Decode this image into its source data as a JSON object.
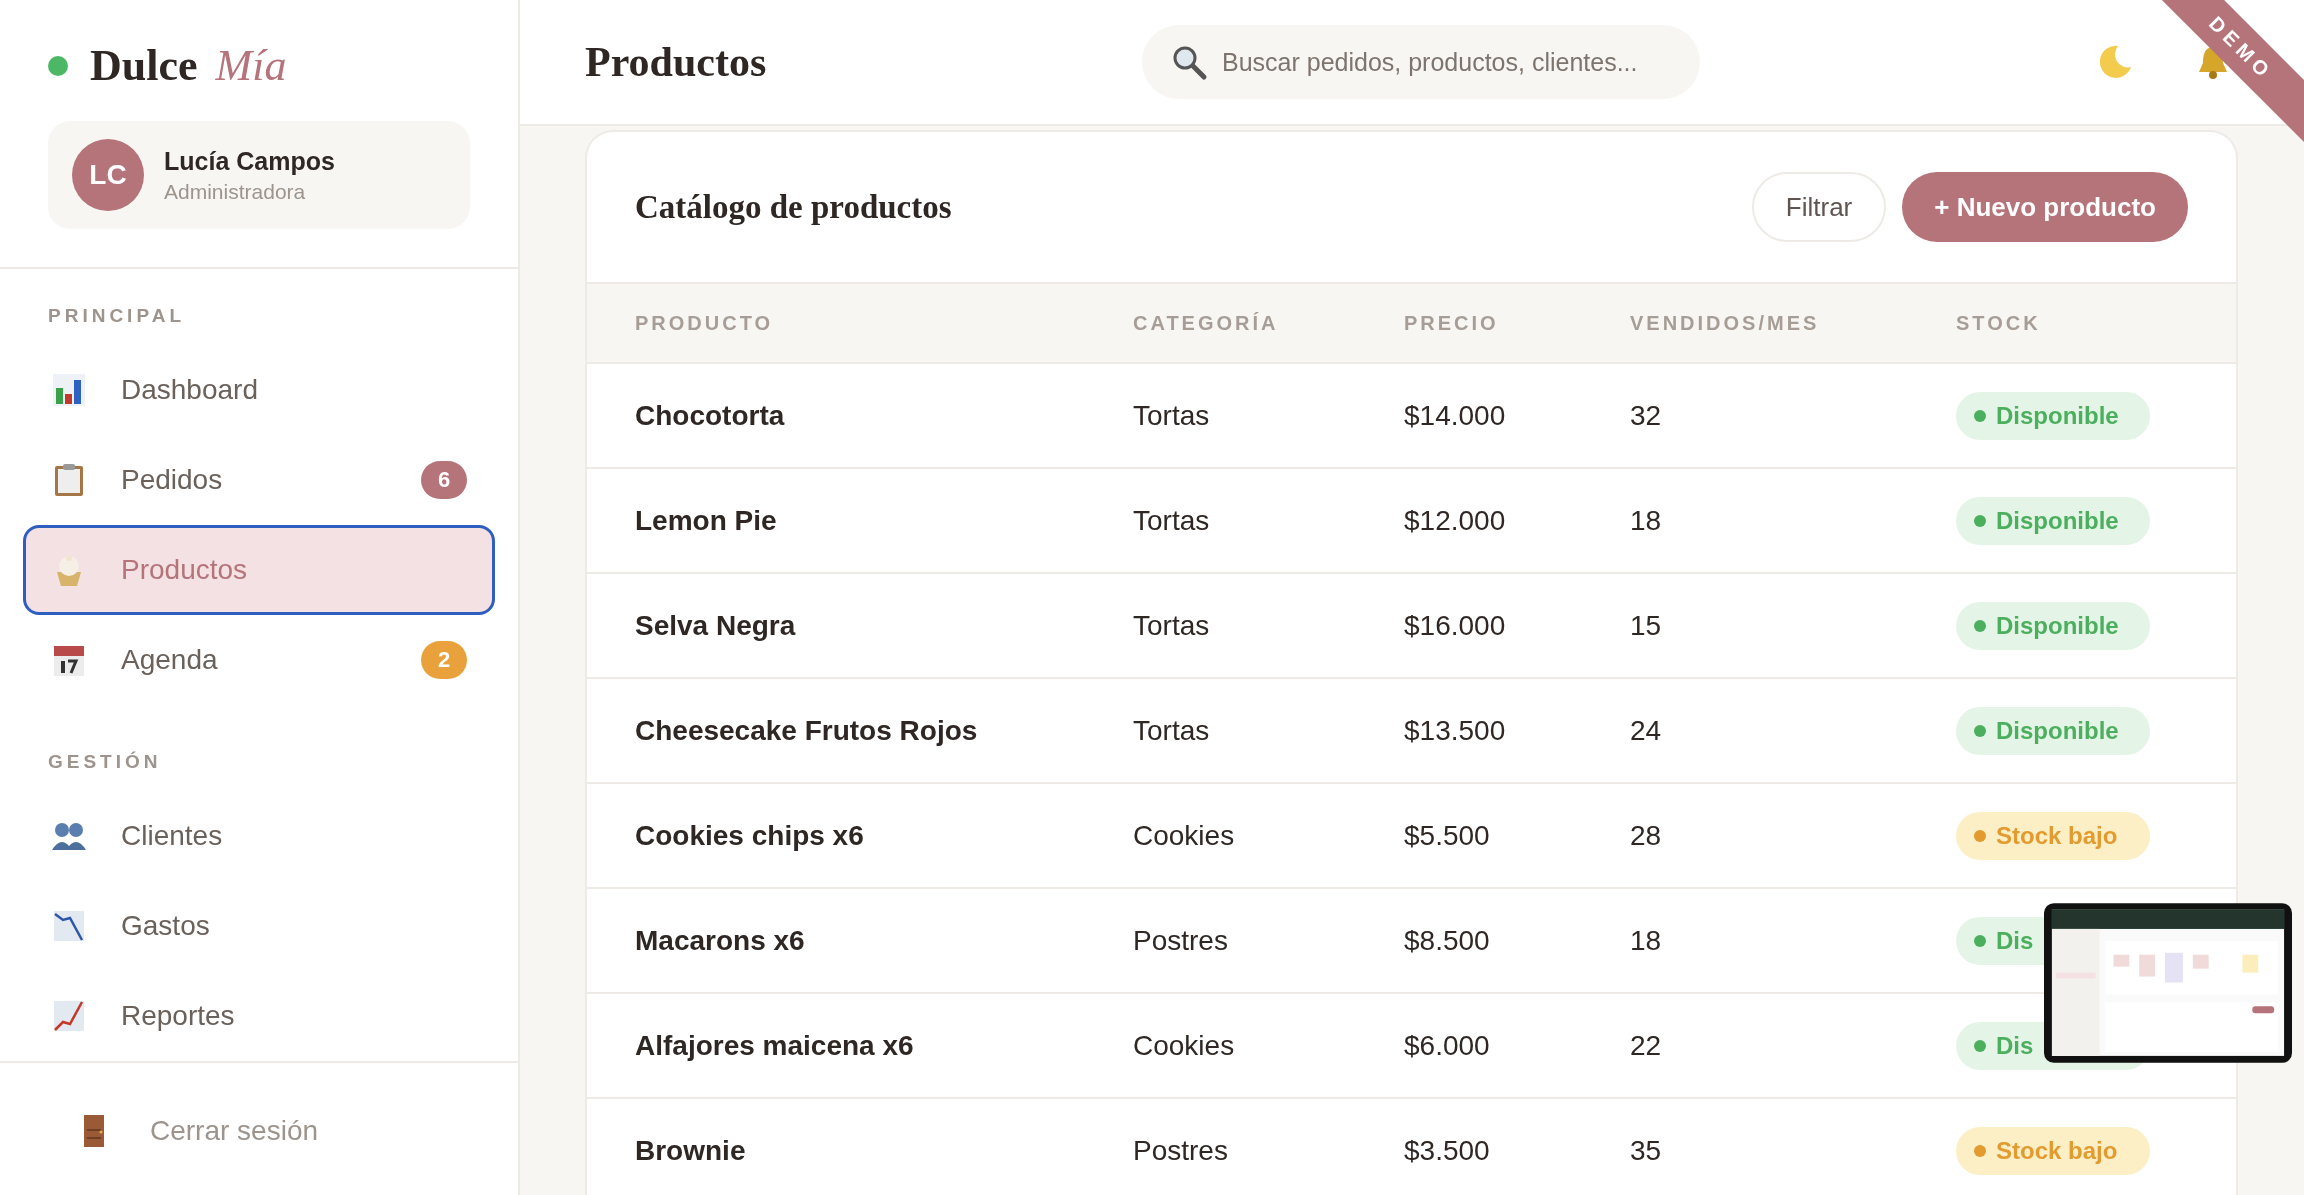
{
  "brand": {
    "name": "Dulce",
    "accent": "Mía"
  },
  "user": {
    "initials": "LC",
    "name": "Lucía Campos",
    "role": "Administradora"
  },
  "nav": [
    {
      "title": "PRINCIPAL",
      "items": [
        {
          "label": "Dashboard",
          "selected": false
        },
        {
          "label": "Pedidos",
          "selected": false,
          "badge": "6",
          "color": "#b5737a"
        },
        {
          "label": "Productos",
          "selected": true
        },
        {
          "label": "Agenda",
          "selected": false,
          "badge": "2",
          "color": "#e9a23b"
        }
      ]
    },
    {
      "title": "GESTIÓN",
      "items": [
        {
          "label": "Clientes",
          "selected": false
        },
        {
          "label": "Gastos",
          "selected": false
        },
        {
          "label": "Reportes",
          "selected": false
        }
      ]
    }
  ],
  "logout": {
    "label": "Cerrar sesión"
  },
  "page_title": "Productos",
  "search": {
    "placeholder": "Buscar pedidos, productos, clientes..."
  },
  "ribbon": "DEMO",
  "card": {
    "title": "Catálogo de productos",
    "buttons": [
      {
        "label": "Filtrar",
        "kind": "secondary"
      },
      {
        "label": "+ Nuevo producto",
        "kind": "primary"
      }
    ]
  },
  "table": {
    "columns": [
      "PRODUCTO",
      "CATEGORÍA",
      "PRECIO",
      "VENDIDOS/MES",
      "STOCK"
    ],
    "rows": [
      {
        "product": "Chocotorta",
        "category": "Tortas",
        "price": "$14.000",
        "sold": "32",
        "stock": {
          "label": "Disponible",
          "kind": "available"
        }
      },
      {
        "product": "Lemon Pie",
        "category": "Tortas",
        "price": "$12.000",
        "sold": "18",
        "stock": {
          "label": "Disponible",
          "kind": "available"
        }
      },
      {
        "product": "Selva Negra",
        "category": "Tortas",
        "price": "$16.000",
        "sold": "15",
        "stock": {
          "label": "Disponible",
          "kind": "available"
        }
      },
      {
        "product": "Cheesecake Frutos Rojos",
        "category": "Tortas",
        "price": "$13.500",
        "sold": "24",
        "stock": {
          "label": "Disponible",
          "kind": "available"
        }
      },
      {
        "product": "Cookies chips x6",
        "category": "Cookies",
        "price": "$5.500",
        "sold": "28",
        "stock": {
          "label": "Stock bajo",
          "kind": "low"
        }
      },
      {
        "product": "Macarons x6",
        "category": "Postres",
        "price": "$8.500",
        "sold": "18",
        "stock": {
          "label": "Dis",
          "kind": "available"
        }
      },
      {
        "product": "Alfajores maicena x6",
        "category": "Cookies",
        "price": "$6.000",
        "sold": "22",
        "stock": {
          "label": "Dis",
          "kind": "available"
        }
      },
      {
        "product": "Brownie",
        "category": "Postres",
        "price": "$3.500",
        "sold": "35",
        "stock": {
          "label": "Stock bajo",
          "kind": "low"
        }
      }
    ]
  }
}
